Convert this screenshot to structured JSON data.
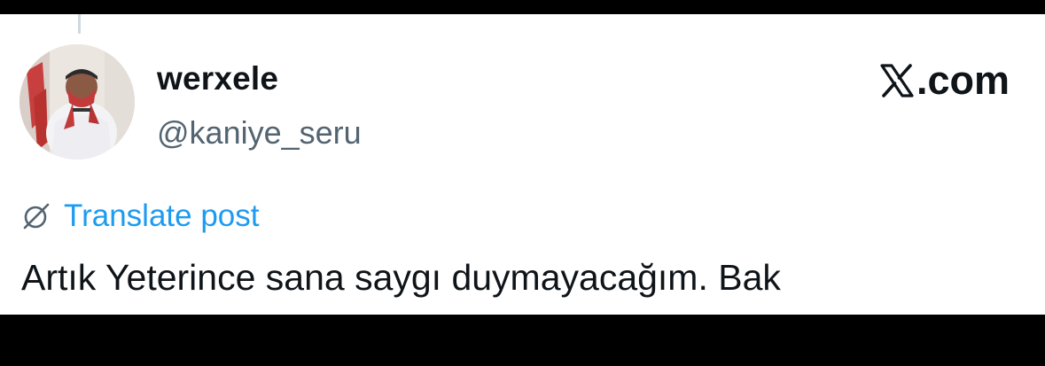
{
  "user": {
    "display_name": "werxele",
    "handle": "@kaniye_seru"
  },
  "brand": {
    "text": ".com",
    "icon": "x-logo-icon"
  },
  "translate": {
    "label": "Translate post",
    "icon": "globe-icon"
  },
  "post": {
    "text": "Artık Yeterince sana saygı duymayacağım. Bak"
  },
  "colors": {
    "link": "#1d9bf0",
    "text": "#0f1419",
    "muted": "#536471",
    "background": "#ffffff",
    "frame": "#000000"
  }
}
